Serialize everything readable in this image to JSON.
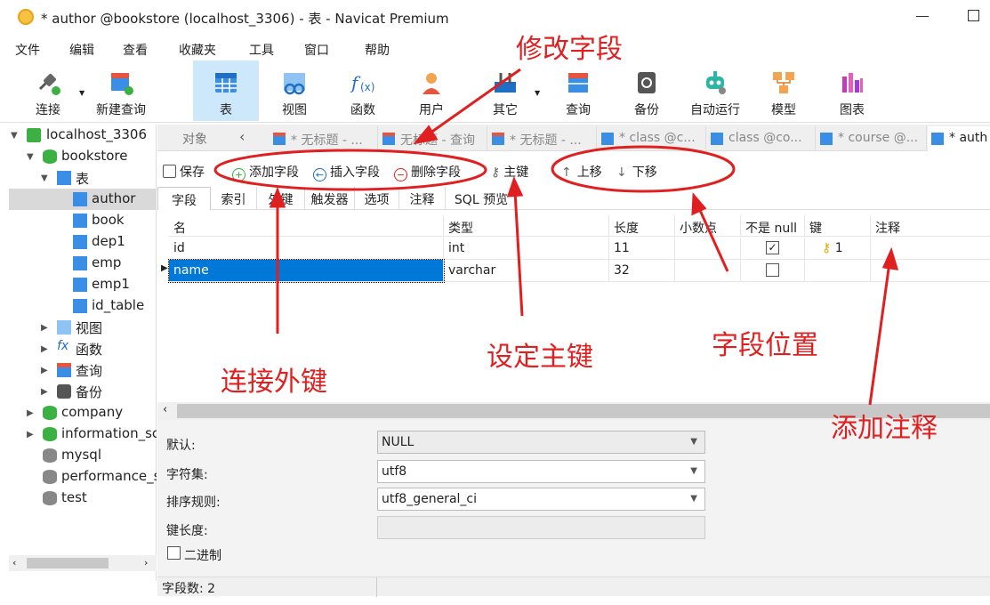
{
  "window": {
    "title": "* author @bookstore (localhost_3306) - 表 - Navicat Premium"
  },
  "menu": [
    "文件",
    "编辑",
    "查看",
    "收藏夹",
    "工具",
    "窗口",
    "帮助"
  ],
  "toolbar": [
    {
      "label": "连接",
      "icon": "plug-icon"
    },
    {
      "label": "新建查询",
      "icon": "new-query-icon"
    },
    {
      "label": "表",
      "icon": "table-icon",
      "active": true
    },
    {
      "label": "视图",
      "icon": "view-icon"
    },
    {
      "label": "函数",
      "icon": "function-icon"
    },
    {
      "label": "用户",
      "icon": "user-icon"
    },
    {
      "label": "其它",
      "icon": "tools-icon"
    },
    {
      "label": "查询",
      "icon": "query-icon"
    },
    {
      "label": "备份",
      "icon": "backup-icon"
    },
    {
      "label": "自动运行",
      "icon": "robot-icon"
    },
    {
      "label": "模型",
      "icon": "model-icon"
    },
    {
      "label": "图表",
      "icon": "chart-icon"
    }
  ],
  "sidebar": {
    "connection": "localhost_3306",
    "database": "bookstore",
    "tables_group": "表",
    "tables": [
      "author",
      "book",
      "dep1",
      "emp",
      "emp1",
      "id_table"
    ],
    "groups": [
      "视图",
      "函数",
      "查询",
      "备份"
    ],
    "databases": [
      "company",
      "information_sc",
      "mysql",
      "performance_s",
      "test"
    ]
  },
  "tabs": {
    "objects": "对象",
    "items": [
      "* 无标题 - ...",
      "无标题 - 查询",
      "* 无标题 - ...",
      "* class @c...",
      "class @co...",
      "* course @...",
      "* auth"
    ]
  },
  "field_toolbar": {
    "save": "保存",
    "add_field": "添加字段",
    "insert_field": "插入字段",
    "delete_field": "删除字段",
    "primary_key": "主键",
    "move_up": "上移",
    "move_down": "下移"
  },
  "subtabs": [
    "字段",
    "索引",
    "外键",
    "触发器",
    "选项",
    "注释",
    "SQL 预览"
  ],
  "grid": {
    "headers": [
      "名",
      "类型",
      "长度",
      "小数点",
      "不是 null",
      "键",
      "注释"
    ],
    "rows": [
      {
        "name": "id",
        "type": "int",
        "length": "11",
        "decimals": "",
        "not_null": true,
        "key": "1",
        "comment": ""
      },
      {
        "name": "name",
        "type": "varchar",
        "length": "32",
        "decimals": "",
        "not_null": false,
        "key": "",
        "comment": ""
      }
    ]
  },
  "properties": {
    "default_label": "默认:",
    "default_value": "NULL",
    "charset_label": "字符集:",
    "charset_value": "utf8",
    "collation_label": "排序规则:",
    "collation_value": "utf8_general_ci",
    "key_length_label": "键长度:",
    "binary_label": "二进制"
  },
  "status": {
    "field_count": "字段数: 2"
  },
  "annotations": {
    "modify_fields": "修改字段",
    "foreign_key": "连接外键",
    "primary_key": "设定主键",
    "field_position": "字段位置",
    "add_comment": "添加注释"
  },
  "colors": {
    "annotation": "#e02020",
    "selection": "#0078d7",
    "active_tool": "#cde8fb"
  }
}
